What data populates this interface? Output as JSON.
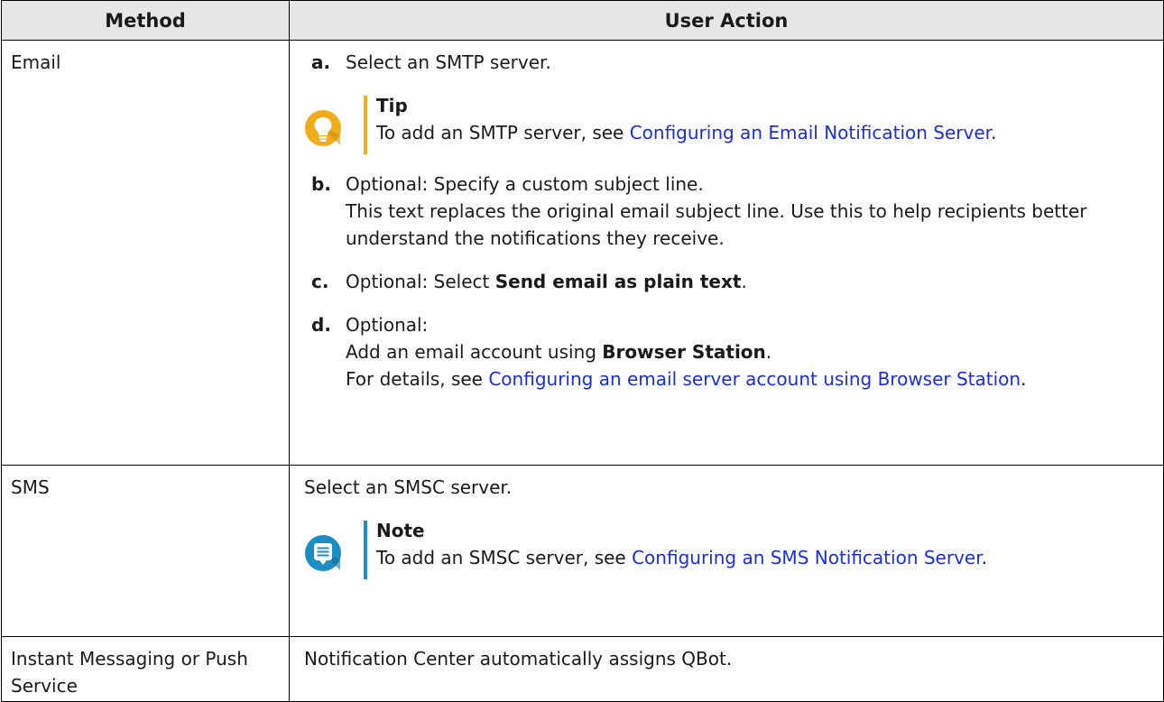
{
  "table": {
    "headers": {
      "method": "Method",
      "user_action": "User Action"
    },
    "email": {
      "method": "Email",
      "step_a": {
        "letter": "a.",
        "text": "Select an SMTP server."
      },
      "tip": {
        "title": "Tip",
        "text_before": "To add an SMTP server, see ",
        "link": "Configuring an Email Notification Server",
        "text_after": "."
      },
      "step_b": {
        "letter": "b.",
        "line1": "Optional: Specify a custom subject line.",
        "line2": "This text replaces the original email subject line. Use this to help recipients better understand the notifications they receive."
      },
      "step_c": {
        "letter": "c.",
        "text_before": "Optional: Select ",
        "bold": "Send email as plain text",
        "text_after": "."
      },
      "step_d": {
        "letter": "d.",
        "line1": "Optional:",
        "line2_before": "Add an email account using ",
        "line2_bold": "Browser Station",
        "line2_after": ".",
        "line3_before": "For details, see ",
        "line3_link": "Configuring an email server account using Browser Station",
        "line3_after": "."
      }
    },
    "sms": {
      "method": "SMS",
      "text": "Select an SMSC server.",
      "note": {
        "title": "Note",
        "text_before": "To add an SMSC server, see ",
        "link": "Configuring an SMS Notification Server",
        "text_after": "."
      }
    },
    "im": {
      "method": "Instant Messaging or Push Service",
      "text": "Notification Center automatically assigns QBot."
    }
  },
  "colors": {
    "tip_accent": "#f0ac1a",
    "note_accent": "#1b8ec4",
    "link": "#1a2ee0",
    "header_bg": "#e6e6e6"
  },
  "icons": {
    "tip": "lightbulb-icon",
    "note": "note-speech-bubble-icon"
  }
}
